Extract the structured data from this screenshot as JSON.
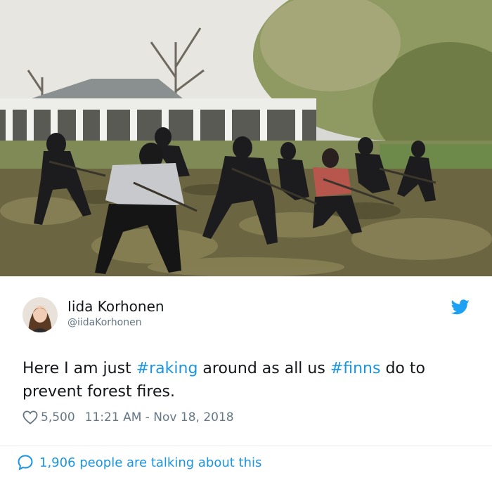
{
  "photo": {
    "description_icon": "raking-people-photo"
  },
  "author": {
    "name": "Iida Korhonen",
    "handle": "@iidaKorhonen",
    "avatar_icon": "avatar-photo"
  },
  "tweet": {
    "text_1": "Here I am just ",
    "hashtag_1": "#raking",
    "text_2": " around as all us ",
    "hashtag_2": "#finns",
    "text_3": " do to prevent forest fires.",
    "likes": "5,500",
    "timestamp": "11:21 AM - Nov 18, 2018"
  },
  "footer": {
    "talking": "1,906 people are talking about this"
  },
  "colors": {
    "link": "#1b95e0",
    "muted": "#657786",
    "text": "#14171a",
    "twitter_blue": "#1da1f2"
  },
  "icons": {
    "platform": "twitter-bird-icon",
    "like": "heart-icon",
    "reply": "speech-bubble-icon"
  }
}
